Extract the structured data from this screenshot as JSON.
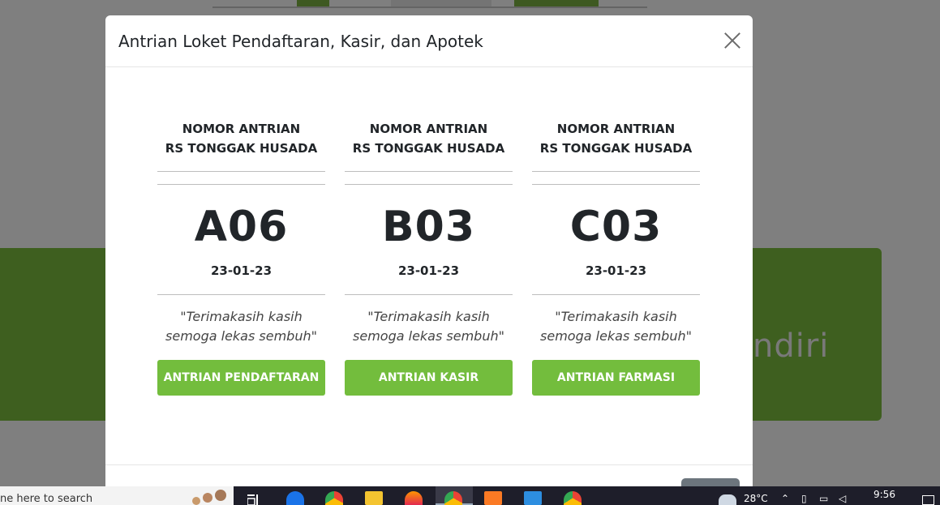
{
  "background": {
    "banner_text": "ndiri"
  },
  "modal": {
    "title": "Antrian Loket Pendaftaran, Kasir, dan Apotek",
    "close_icon": "close-icon",
    "cards": [
      {
        "heading_line1": "NOMOR ANTRIAN",
        "heading_line2": "RS TONGGAK HUSADA",
        "number": "A06",
        "date": "23-01-23",
        "message_line1": "\"Terimakasih kasih",
        "message_line2": "semoga lekas sembuh\"",
        "button_label": "ANTRIAN PENDAFTARAN"
      },
      {
        "heading_line1": "NOMOR ANTRIAN",
        "heading_line2": "RS TONGGAK HUSADA",
        "number": "B03",
        "date": "23-01-23",
        "message_line1": "\"Terimakasih kasih",
        "message_line2": "semoga lekas sembuh\"",
        "button_label": "ANTRIAN KASIR"
      },
      {
        "heading_line1": "NOMOR ANTRIAN",
        "heading_line2": "RS TONGGAK HUSADA",
        "number": "C03",
        "date": "23-01-23",
        "message_line1": "\"Terimakasih kasih",
        "message_line2": "semoga lekas sembuh\"",
        "button_label": "ANTRIAN FARMASI"
      }
    ]
  },
  "colors": {
    "accent_green": "#73bd3d",
    "banner_green": "#7cbf3f"
  },
  "taskbar": {
    "search_text": "ne here to search",
    "weather": "28°C",
    "time": "9:56",
    "icons": [
      "task-view-icon",
      "search-app-icon",
      "chrome-icon",
      "file-explorer-icon",
      "firefox-icon",
      "chrome-active-icon",
      "xampp-icon",
      "vscode-icon",
      "chrome-alt-icon"
    ]
  }
}
